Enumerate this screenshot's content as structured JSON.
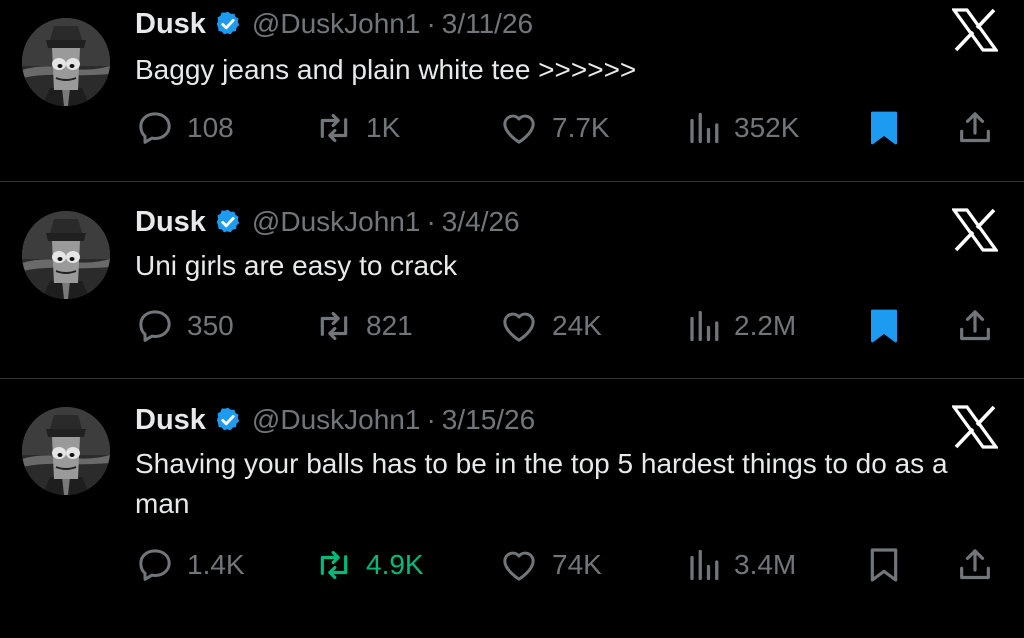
{
  "colors": {
    "background": "#000000",
    "text": "#e7e9ea",
    "muted": "#71767b",
    "verified": "#1d9bf0",
    "bookmarked": "#1d9bf0",
    "retweeted": "#00ba7c",
    "divider": "#2f3336"
  },
  "tweets": [
    {
      "name": "Dusk",
      "handle": "@DuskJohn1",
      "separator": "·",
      "date": "3/11/26",
      "text": "Baggy jeans and plain white tee >>>>>>",
      "replies": "108",
      "retweets": "1K",
      "likes": "7.7K",
      "views": "352K",
      "bookmarked": true,
      "retweeted": false
    },
    {
      "name": "Dusk",
      "handle": "@DuskJohn1",
      "separator": "·",
      "date": "3/4/26",
      "text": "Uni girls are easy to crack",
      "replies": "350",
      "retweets": "821",
      "likes": "24K",
      "views": "2.2M",
      "bookmarked": true,
      "retweeted": false
    },
    {
      "name": "Dusk",
      "handle": "@DuskJohn1",
      "separator": "·",
      "date": "3/15/26",
      "text": "Shaving your balls has to be in the top 5 hardest things to do as a man",
      "replies": "1.4K",
      "retweets": "4.9K",
      "likes": "74K",
      "views": "3.4M",
      "bookmarked": false,
      "retweeted": true
    }
  ],
  "icons": {
    "avatar": "cartoon-avatar-icon",
    "verified": "verified-badge-icon",
    "x_logo": "x-logo-icon",
    "reply": "reply-icon",
    "retweet": "retweet-icon",
    "like": "heart-icon",
    "views": "views-icon",
    "bookmark": "bookmark-icon",
    "share": "share-icon"
  }
}
